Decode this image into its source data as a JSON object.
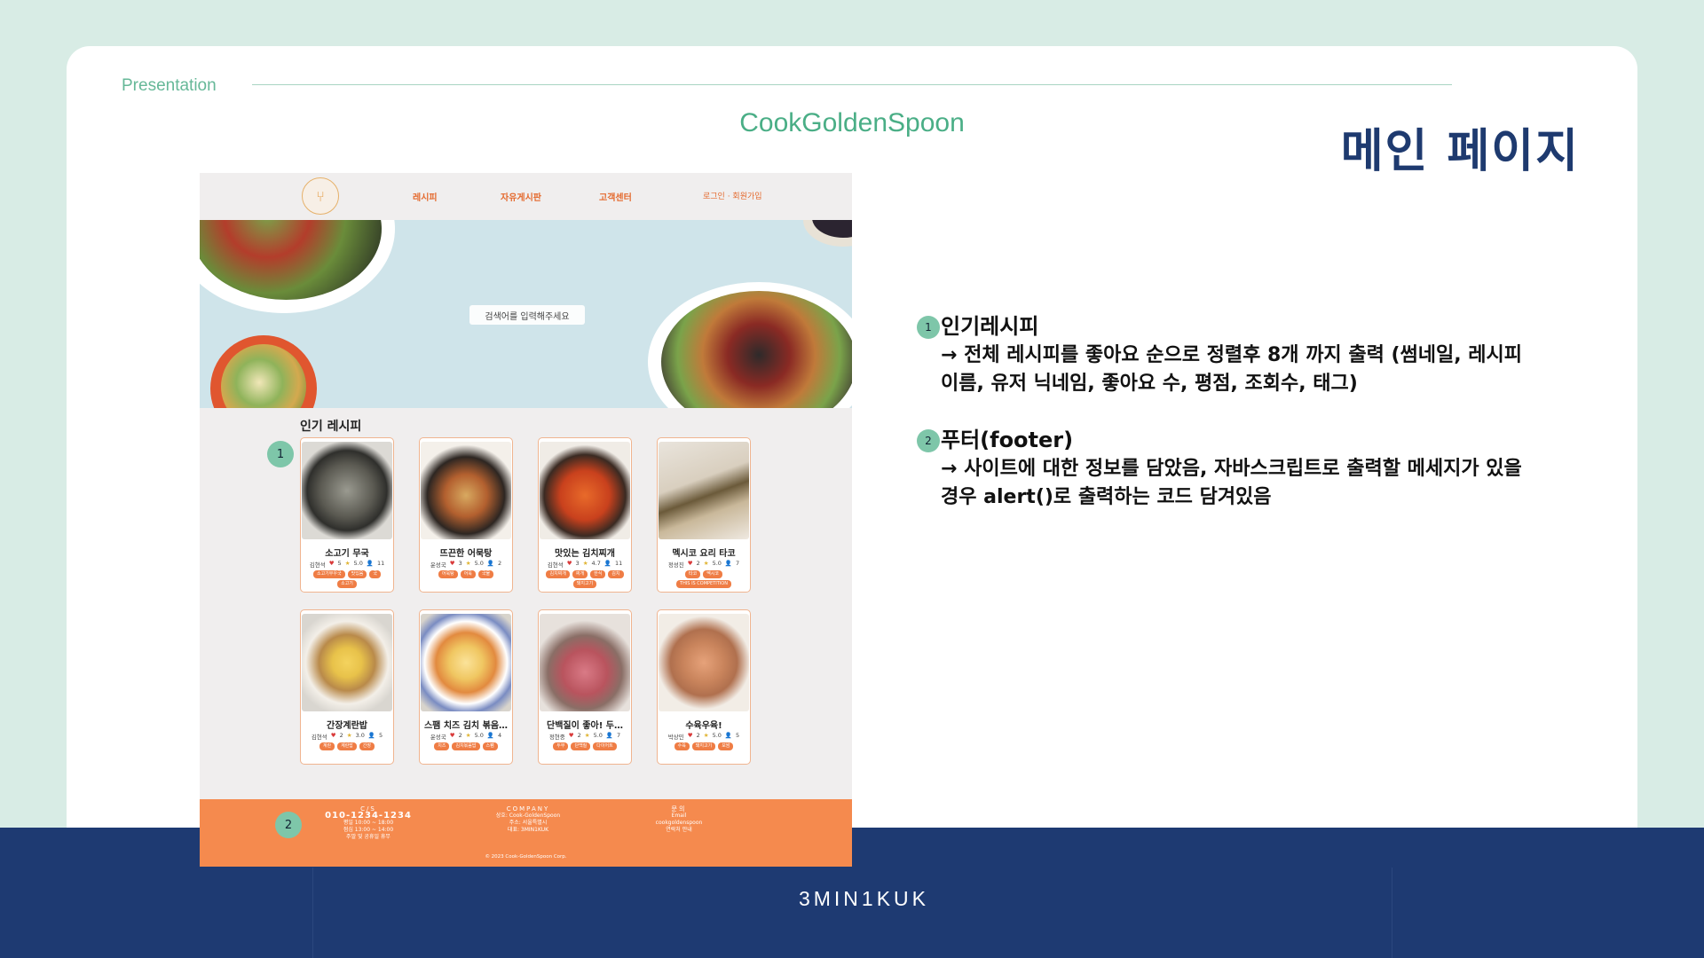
{
  "slide": {
    "kicker": "Presentation",
    "subtitle": "CookGoldenSpoon",
    "heading": "메인 페이지",
    "brand": "3MIN1KUK"
  },
  "site": {
    "nav": {
      "links": [
        "레시피",
        "자유게시판",
        "고객센터"
      ],
      "login": "로그인 · 회원가입"
    },
    "search_placeholder": "검색어를 입력해주세요",
    "section_title": "인기 레시피",
    "cards": [
      {
        "title": "소고기 무국",
        "author": "김현석",
        "likes": "5",
        "rating": "5.0",
        "views": "11",
        "tags": [
          "소고기무우국",
          "맛있음",
          "국",
          "소고기"
        ]
      },
      {
        "title": "뜨끈한 어묵탕",
        "author": "윤성국",
        "likes": "3",
        "rating": "5.0",
        "views": "2",
        "tags": [
          "어묵탕",
          "어묵",
          "국물"
        ]
      },
      {
        "title": "맛있는 김치찌개",
        "author": "김현석",
        "likes": "3",
        "rating": "4.7",
        "views": "11",
        "tags": [
          "김치찌개",
          "찌개",
          "한식",
          "김치",
          "돼지고기"
        ]
      },
      {
        "title": "멕시코 요리 타코",
        "author": "정성진",
        "likes": "2",
        "rating": "5.0",
        "views": "7",
        "tags": [
          "타코",
          "멕시코",
          "THIS IS COMPETITION"
        ]
      },
      {
        "title": "간장계란밥",
        "author": "김현석",
        "likes": "2",
        "rating": "3.0",
        "views": "5",
        "tags": [
          "계란",
          "계란밥",
          "간장"
        ]
      },
      {
        "title": "스팸 치즈 김치 볶음…",
        "author": "윤성국",
        "likes": "2",
        "rating": "5.0",
        "views": "4",
        "tags": [
          "치즈",
          "김치볶음밥",
          "스팸"
        ]
      },
      {
        "title": "단백질이 좋아! 두…",
        "author": "정현중",
        "likes": "2",
        "rating": "5.0",
        "views": "7",
        "tags": [
          "두부",
          "단백질",
          "다이어트"
        ]
      },
      {
        "title": "수육우육!",
        "author": "박상민",
        "likes": "2",
        "rating": "5.0",
        "views": "5",
        "tags": [
          "수육",
          "돼지고기",
          "보쌈"
        ]
      }
    ],
    "footer": {
      "cs_head": "C/S",
      "phone": "010-1234-1234",
      "cs_lines": [
        "평일 10:00 ~ 18:00",
        "점심 13:00 ~ 14:00",
        "주말 및 공휴일 휴무"
      ],
      "company_head": "COMPANY",
      "company_lines": [
        "상호: Cook-GoldenSpoon",
        "주소: 서울특별시",
        "대표: 3MIN1KUK"
      ],
      "contact_head": "문의",
      "contact_lines": [
        "Email",
        "cookgoldenspoon",
        "연락처 안내"
      ],
      "copyright": "© 2023 Cook-GoldenSpoon Corp."
    }
  },
  "markers": [
    "1",
    "2"
  ],
  "notes": [
    {
      "number": "1",
      "title": "인기레시피",
      "body": "→ 전체 레시피를 좋아요 순으로 정렬후 8개 까지 출력 (썸네일, 레시피 이름, 유저 닉네임, 좋아요 수, 평점, 조회수, 태그)"
    },
    {
      "number": "2",
      "title": "푸터(footer)",
      "body": "→ 사이트에 대한 정보를 담았음, 자바스크립트로 출력할 메세지가 있을 경우 alert()로 출력하는 코드 담겨있음"
    }
  ],
  "colors": {
    "accent_green": "#4aae86",
    "heading_navy": "#1e3a6f",
    "site_orange": "#f58a4e",
    "marker_green": "#7ec6a9"
  }
}
